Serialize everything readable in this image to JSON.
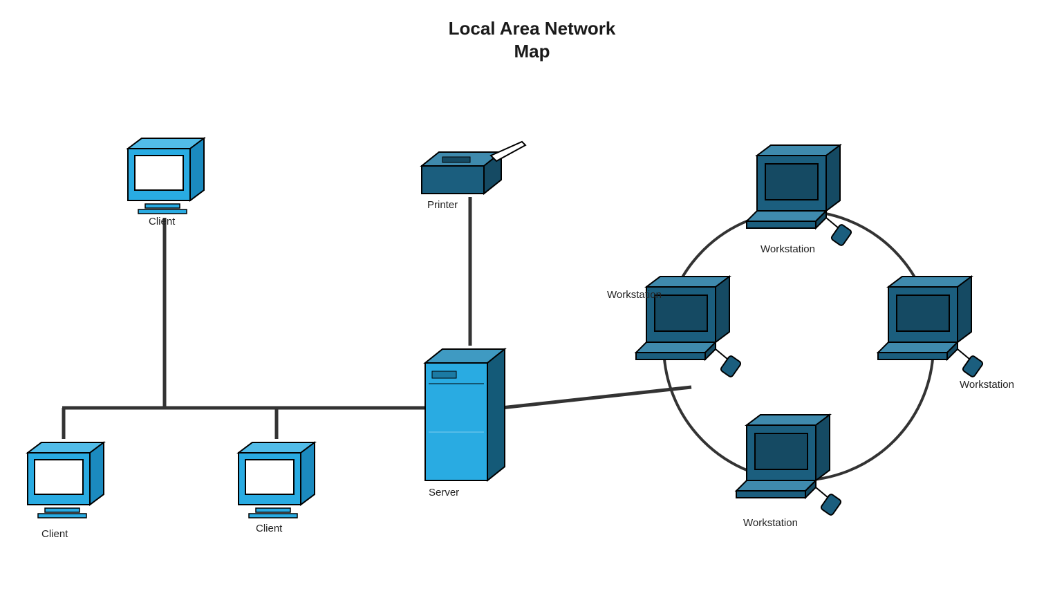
{
  "title_line1": "Local Area Network",
  "title_line2": "Map",
  "nodes": {
    "client1": {
      "label": "Client"
    },
    "client2": {
      "label": "Client"
    },
    "client3": {
      "label": "Client"
    },
    "printer": {
      "label": "Printer"
    },
    "server": {
      "label": "Server"
    },
    "ws1": {
      "label": "Workstation"
    },
    "ws2": {
      "label": "Workstation"
    },
    "ws3": {
      "label": "Workstation"
    },
    "ws4": {
      "label": "Workstation"
    }
  },
  "colors": {
    "client_fill": "#29abe2",
    "client_dark": "#1b7aa3",
    "ws_fill": "#1b5e7e",
    "ws_light": "#3f8aad",
    "stroke": "#000000",
    "link": "#333333"
  }
}
